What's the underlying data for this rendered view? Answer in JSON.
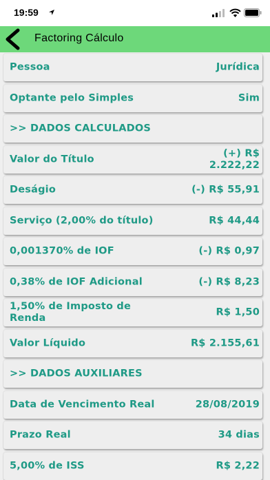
{
  "status_bar": {
    "time": "19:59"
  },
  "header": {
    "title": "Factoring Cálculo"
  },
  "rows": [
    {
      "label": "Pessoa",
      "value": "Jurídica"
    },
    {
      "label": "Optante pelo Simples",
      "value": "Sim"
    },
    {
      "label": ">> DADOS CALCULADOS",
      "value": ""
    },
    {
      "label": "Valor do Título",
      "value": "(+) R$ 2.222,22"
    },
    {
      "label": "Deságio",
      "value": "(-) R$ 55,91"
    },
    {
      "label": "Serviço (2,00% do título)",
      "value": "R$ 44,44"
    },
    {
      "label": "0,001370% de IOF",
      "value": "(-) R$ 0,97"
    },
    {
      "label": "0,38% de IOF Adicional",
      "value": "(-) R$ 8,23"
    },
    {
      "label": "1,50% de Imposto de Renda",
      "value": "R$ 1,50"
    },
    {
      "label": "Valor Líquido",
      "value": "R$ 2.155,61"
    },
    {
      "label": ">> DADOS AUXILIARES",
      "value": ""
    },
    {
      "label": "Data de Vencimento Real",
      "value": "28/08/2019"
    },
    {
      "label": "Prazo Real",
      "value": "34 dias"
    },
    {
      "label": "5,00% de ISS",
      "value": "R$ 2,22"
    }
  ],
  "colors": {
    "header": "#6dd87a",
    "text": "#1f9a86",
    "row_bg": "#eeeeee"
  }
}
